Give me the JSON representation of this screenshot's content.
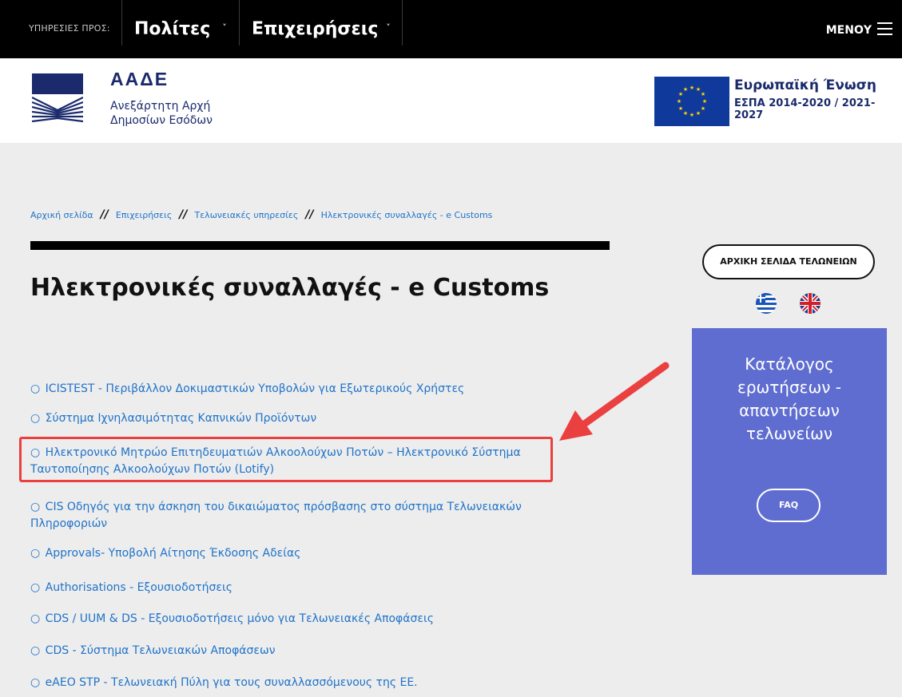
{
  "topbar": {
    "services_label": "ΥΠΗΡΕΣΙΕΣ ΠΡΟΣ:",
    "nav": [
      {
        "label": "Πολίτες"
      },
      {
        "label": "Επιχειρήσεις"
      }
    ],
    "menu_label": "ΜΕΝΟΥ"
  },
  "header": {
    "brand_name": "ΑΑΔΕ",
    "brand_line1": "Ανεξάρτητη Αρχή",
    "brand_line2": "Δημοσίων Εσόδων",
    "eu_title": "Ευρωπαϊκή Ένωση",
    "eu_subtitle": "ΕΣΠΑ 2014-2020 / 2021-2027"
  },
  "breadcrumb": [
    {
      "label": "Αρχική σελίδα"
    },
    {
      "label": "Επιχειρήσεις"
    },
    {
      "label": "Τελωνειακές υπηρεσίες"
    },
    {
      "label": "Ηλεκτρονικές συναλλαγές - e Customs"
    }
  ],
  "breadcrumb_separator": "//",
  "page_title": "Ηλεκτρονικές συναλλαγές - e Customs",
  "links": [
    {
      "line1": "ICISTEST - Περιβάλλον Δοκιμαστικών Υποβολών για Εξωτερικούς Χρήστες",
      "line2": ""
    },
    {
      "line1": "Σύστημα Ιχνηλασιμότητας Καπνικών Προϊόντων",
      "line2": ""
    },
    {
      "line1": "Ηλεκτρονικό Μητρώο Επιτηδευματιών Αλκοολούχων Ποτών – Ηλεκτρονικό Σύστημα",
      "line2": "Ταυτοποίησης Αλκοολούχων Ποτών (Lotify)"
    },
    {
      "line1": "CIS Οδηγός για την άσκηση του δικαιώματος πρόσβασης στο σύστημα Τελωνειακών",
      "line2": "Πληροφοριών"
    },
    {
      "line1": "Approvals- Υποβολή Αίτησης Έκδοσης Αδείας",
      "line2": ""
    },
    {
      "line1": "Authorisations - Εξουσιοδοτήσεις",
      "line2": ""
    },
    {
      "line1": "CDS / UUM & DS - Εξουσιοδοτήσεις μόνο για Τελωνειακές Αποφάσεις",
      "line2": ""
    },
    {
      "line1": "CDS - Σύστημα Τελωνειακών Αποφάσεων",
      "line2": ""
    },
    {
      "line1": "eAEO STP - Τελωνειακή Πύλη για τους συναλλασσόμενους της ΕΕ.",
      "line2": ""
    }
  ],
  "bullet": "○",
  "sidebar": {
    "customs_home_label": "ΑΡΧΙΚΗ ΣΕΛΙΔΑ ΤΕΛΩΝΕΙΩΝ",
    "faq_title_lines": [
      "Κατάλογος",
      "ερωτήσεων -",
      "απαντήσεων",
      "τελωνείων"
    ],
    "faq_button": "FAQ"
  },
  "colors": {
    "link": "#1f73c9",
    "faq_panel": "#5f6dd0",
    "highlight": "#ea4040",
    "brand": "#1a2a6c"
  }
}
